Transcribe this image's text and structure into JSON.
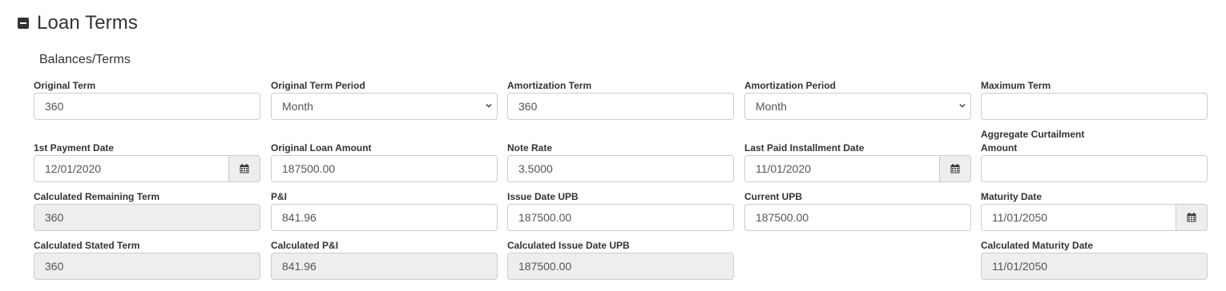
{
  "section": {
    "title": "Loan Terms"
  },
  "subsection": {
    "title": "Balances/Terms"
  },
  "fields": {
    "original_term": {
      "label": "Original Term",
      "value": "360"
    },
    "original_term_period": {
      "label": "Original Term Period",
      "value": "Month"
    },
    "amortization_term": {
      "label": "Amortization Term",
      "value": "360"
    },
    "amortization_period": {
      "label": "Amortization Period",
      "value": "Month"
    },
    "maximum_term": {
      "label": "Maximum Term",
      "value": ""
    },
    "first_payment_date": {
      "label": "1st Payment Date",
      "value": "12/01/2020"
    },
    "original_loan_amount": {
      "label": "Original Loan Amount",
      "value": "187500.00"
    },
    "note_rate": {
      "label": "Note Rate",
      "value": "3.5000"
    },
    "last_paid_installment_date": {
      "label": "Last Paid Installment Date",
      "value": "11/01/2020"
    },
    "aggregate_curtailment_amount": {
      "label_line1": "Aggregate Curtailment",
      "label_line2": "Amount",
      "value": ""
    },
    "calculated_remaining_term": {
      "label": "Calculated Remaining Term",
      "value": "360"
    },
    "p_and_i": {
      "label": "P&I",
      "value": "841.96"
    },
    "issue_date_upb": {
      "label": "Issue Date UPB",
      "value": "187500.00"
    },
    "current_upb": {
      "label": "Current UPB",
      "value": "187500.00"
    },
    "maturity_date": {
      "label": "Maturity Date",
      "value": "11/01/2050"
    },
    "calculated_stated_term": {
      "label": "Calculated Stated Term",
      "value": "360"
    },
    "calculated_p_and_i": {
      "label": "Calculated P&I",
      "value": "841.96"
    },
    "calculated_issue_date_upb": {
      "label": "Calculated Issue Date UPB",
      "value": "187500.00"
    },
    "calculated_maturity_date": {
      "label": "Calculated Maturity Date",
      "value": "11/01/2050"
    }
  },
  "icons": {
    "section_toggle": "collapse-minus-icon",
    "date_picker": "calendar-icon",
    "select_arrow": "chevron-down-icon"
  }
}
